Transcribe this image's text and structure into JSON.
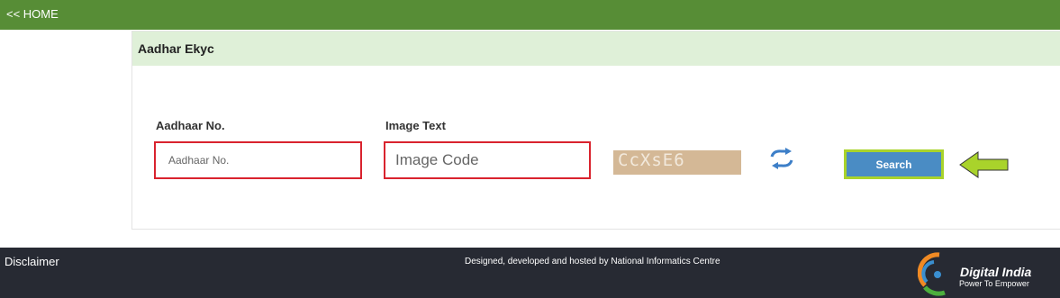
{
  "nav": {
    "home_label": "<< HOME"
  },
  "panel": {
    "title": "Aadhar Ekyc"
  },
  "form": {
    "aadhaar_label": "Aadhaar No.",
    "aadhaar_placeholder": "Aadhaar No.",
    "aadhaar_value": "",
    "image_text_label": "Image Text",
    "image_code_placeholder": "Image Code",
    "image_code_value": "",
    "captcha_text": "CcXsE6",
    "search_label": "Search"
  },
  "footer": {
    "disclaimer": "Disclaimer",
    "credit": "Designed, developed and hosted by National Informatics Centre",
    "logo_title": "Digital India",
    "logo_tagline": "Power To Empower"
  },
  "colors": {
    "topbar": "#578d36",
    "panel_header": "#dff0d8",
    "input_border": "#d9232e",
    "button_bg": "#4a8cc4",
    "button_border": "#a9d32b",
    "arrow": "#a9d32b",
    "footer": "#272a33"
  },
  "icons": {
    "refresh": "refresh-icon",
    "pointer_arrow": "left-arrow-icon",
    "logo": "digital-india-logo"
  }
}
